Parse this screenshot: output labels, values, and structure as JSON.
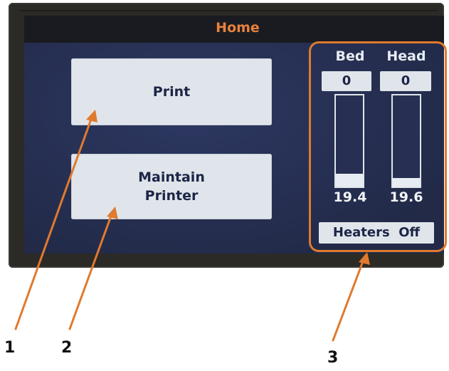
{
  "screen": {
    "title": "Home"
  },
  "buttons": {
    "print": "Print",
    "maintain_line1": "Maintain",
    "maintain_line2": "Printer"
  },
  "temperatures": {
    "bed": {
      "label": "Bed",
      "setpoint": "0",
      "current": "19.4",
      "fill_fraction": 0.14
    },
    "head": {
      "label": "Head",
      "setpoint": "0",
      "current": "19.6",
      "fill_fraction": 0.09
    },
    "heaters_status": "Heaters  Off"
  },
  "callouts": [
    "1",
    "2",
    "3"
  ],
  "colors": {
    "title": "#e8823e",
    "screen_background": "#273053",
    "button_background": "#dfe5ea",
    "callout_arrow": "#e07a2e"
  }
}
